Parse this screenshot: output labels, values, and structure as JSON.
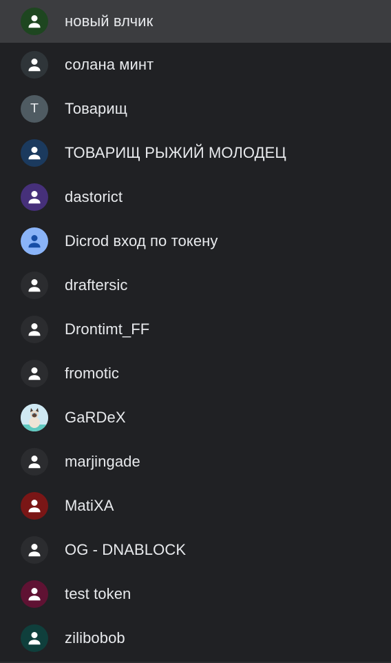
{
  "profiles": [
    {
      "name": "новый влчик",
      "avatar": {
        "type": "person-icon",
        "bg": "#1e4620",
        "fg": "#ffffff"
      }
    },
    {
      "name": "солана минт",
      "avatar": {
        "type": "person-icon",
        "bg": "#2f3539",
        "fg": "#ffffff"
      }
    },
    {
      "name": "Товарищ",
      "avatar": {
        "type": "letter",
        "letter": "Т",
        "bg": "#4f5b62",
        "fg": "#e8eaed"
      }
    },
    {
      "name": "ТОВАРИЩ РЫЖИЙ МОЛОДЕЦ",
      "avatar": {
        "type": "person-icon",
        "bg": "#1b3a5e",
        "fg": "#ffffff"
      }
    },
    {
      "name": "dastorict",
      "avatar": {
        "type": "person-icon",
        "bg": "#46307a",
        "fg": "#ffffff"
      }
    },
    {
      "name": "Dicrod вход по токену",
      "avatar": {
        "type": "person-icon",
        "bg": "#8ab4f8",
        "fg": "#174ea6"
      }
    },
    {
      "name": "draftersic",
      "avatar": {
        "type": "person-icon",
        "bg": "#2b2c2f",
        "fg": "#ffffff"
      }
    },
    {
      "name": "Drontimt_FF",
      "avatar": {
        "type": "person-icon",
        "bg": "#2b2c2f",
        "fg": "#ffffff"
      }
    },
    {
      "name": "fromotic",
      "avatar": {
        "type": "person-icon",
        "bg": "#2b2c2f",
        "fg": "#ffffff"
      }
    },
    {
      "name": "GaRDeX",
      "avatar": {
        "type": "cat-photo",
        "bg": "#bfe3f0",
        "fg": "#ffffff"
      }
    },
    {
      "name": "marjingade",
      "avatar": {
        "type": "person-icon",
        "bg": "#2b2c2f",
        "fg": "#ffffff"
      }
    },
    {
      "name": "MatiXA",
      "avatar": {
        "type": "person-icon",
        "bg": "#7a1616",
        "fg": "#ffffff"
      }
    },
    {
      "name": "OG - DNABLOCK",
      "avatar": {
        "type": "person-icon",
        "bg": "#2b2c2f",
        "fg": "#ffffff"
      }
    },
    {
      "name": "test token",
      "avatar": {
        "type": "person-icon",
        "bg": "#5f1233",
        "fg": "#ffffff"
      }
    },
    {
      "name": "zilibobob",
      "avatar": {
        "type": "person-icon",
        "bg": "#0f3f3c",
        "fg": "#ffffff"
      }
    }
  ]
}
